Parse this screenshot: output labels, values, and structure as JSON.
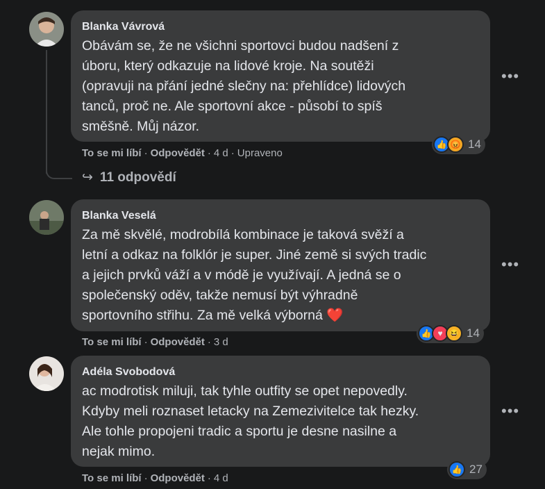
{
  "comments": [
    {
      "author": "Blanka Vávrová",
      "text": "Obávám se, že ne všichni sportovci budou nadšení z\núboru, který odkazuje na lidové kroje. Na soutěži\n(opravuji na přání jedné slečny na: přehlídce) lidových\ntanců, proč ne. Ale sportovní akce - působí to spíš\nsměšně. Můj názor.",
      "like_label": "To se mi líbí",
      "reply_label": "Odpovědět",
      "time": "4 d",
      "edited": "Upraveno",
      "reaction_count": "14",
      "reaction_icons": [
        "like-icon",
        "angry-icon"
      ],
      "replies_label": "11 odpovědí"
    },
    {
      "author": "Blanka Veselá",
      "text": "Za mě skvělé, modrobílá kombinace je taková svěží a\nletní a odkaz na folklór je super. Jiné země si svých tradic\na jejich prvků váží a v módě je využívají. A jedná se o\nspolečenský oděv, takže nemusí být výhradně\nsportovního střihu. Za mě velká výborná ❤️",
      "like_label": "To se mi líbí",
      "reply_label": "Odpovědět",
      "time": "3 d",
      "reaction_count": "14",
      "reaction_icons": [
        "like-icon",
        "love-icon",
        "haha-icon"
      ]
    },
    {
      "author": "Adéla Svobodová",
      "text": "ac modrotisk miluji, tak tyhle outfity se opet nepovedly.\nKdyby meli roznaset letacky na Zemezivitelce tak hezky.\nAle tohle propojeni tradic a sportu je desne nasilne a\nnejak mimo.",
      "like_label": "To se mi líbí",
      "reply_label": "Odpovědět",
      "time": "4 d",
      "reaction_count": "27",
      "reaction_icons": [
        "like-icon"
      ]
    }
  ],
  "separator": "·",
  "more_label": "•••",
  "colors": {
    "background": "#18191a",
    "bubble": "#3a3b3c",
    "text": "#e4e6eb",
    "muted": "#b0b3b8",
    "like": "#1877f2"
  }
}
